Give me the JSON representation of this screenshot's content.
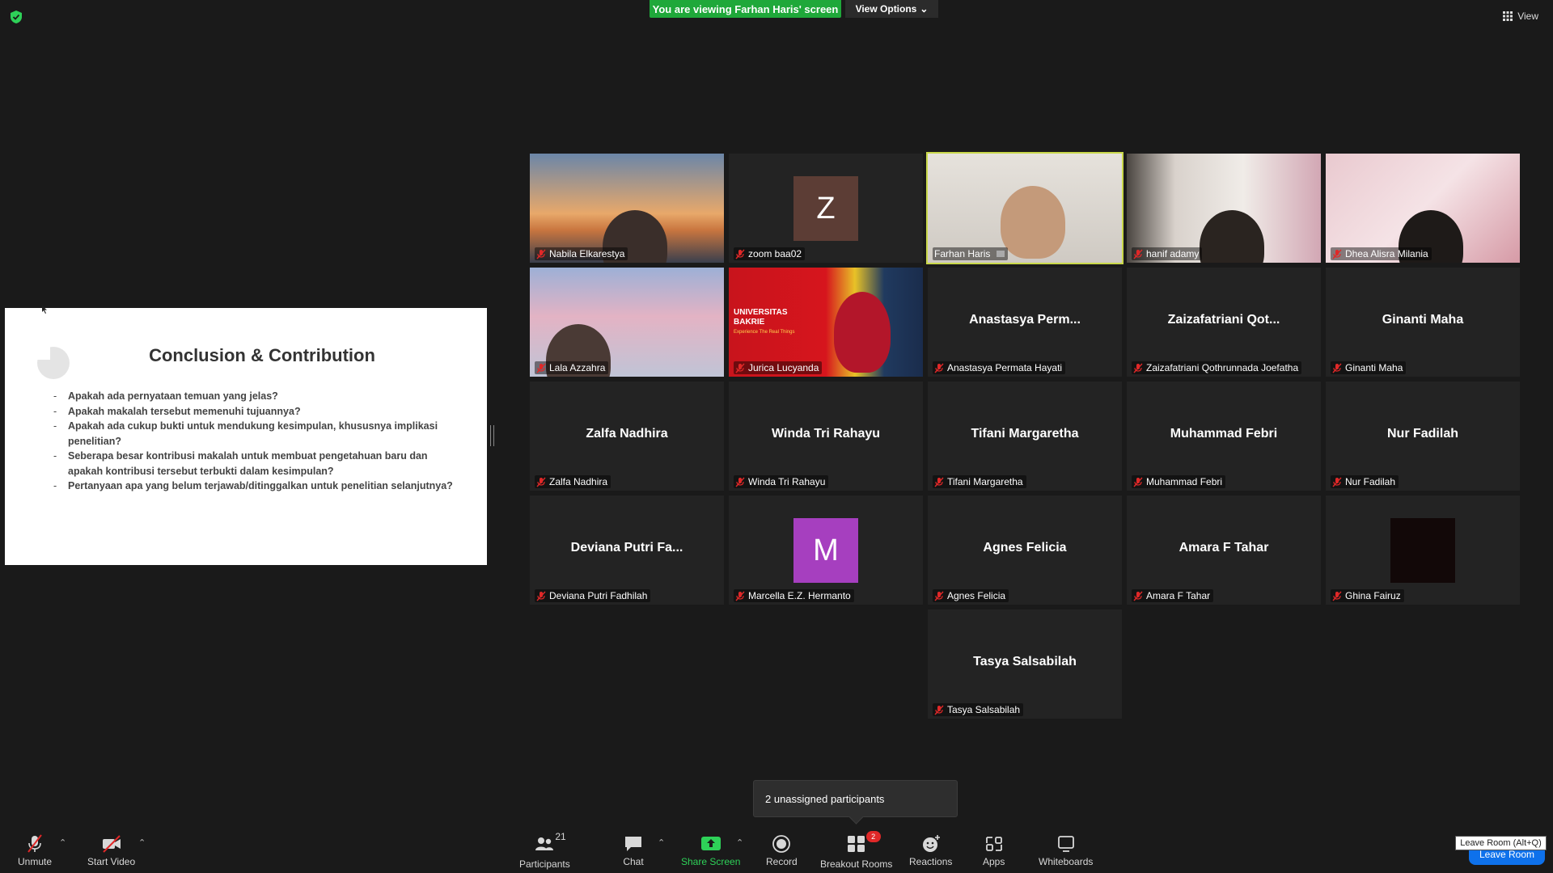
{
  "top": {
    "viewing_banner": "You are viewing Farhan Haris' screen",
    "view_options": "View Options",
    "view_button": "View"
  },
  "slide": {
    "title": "Conclusion & Contribution",
    "bullets": [
      "Apakah ada pernyataan temuan yang jelas?",
      "Apakah makalah tersebut memenuhi tujuannya?",
      "Apakah ada cukup bukti untuk mendukung kesimpulan, khususnya implikasi penelitian?",
      "Seberapa besar kontribusi makalah untuk membuat pengetahuan baru dan apakah kontribusi tersebut terbukti dalam kesimpulan?",
      "Pertanyaan apa yang belum terjawab/ditinggalkan untuk penelitian selanjutnya?"
    ]
  },
  "participants": [
    {
      "name": "Nabila Elkarestya",
      "kind": "video",
      "scene": "bridge"
    },
    {
      "name": "zoom baa02",
      "kind": "avatar",
      "avatar_letter": "Z",
      "avatar_color": "#5c3d35"
    },
    {
      "name": "Farhan Haris",
      "kind": "video",
      "scene": "room",
      "active": true
    },
    {
      "name": "hanif adamy",
      "kind": "video",
      "scene": "curtain"
    },
    {
      "name": "Dhea Alisra Milania",
      "kind": "video",
      "scene": "flower"
    },
    {
      "name": "Lala Azzahra",
      "kind": "video",
      "scene": "pink"
    },
    {
      "name": "Jurica Lucyanda",
      "kind": "video",
      "scene": "bakrie"
    },
    {
      "name": "Anastasya Permata Hayati",
      "kind": "name",
      "display": "Anastasya  Perm..."
    },
    {
      "name": "Zaizafatriani Qothrunnada Joefatha",
      "kind": "name",
      "display": "Zaizafatriani  Qot..."
    },
    {
      "name": "Ginanti Maha",
      "kind": "name",
      "display": "Ginanti Maha"
    },
    {
      "name": "Zalfa Nadhira",
      "kind": "name",
      "display": "Zalfa Nadhira"
    },
    {
      "name": "Winda Tri Rahayu",
      "kind": "name",
      "display": "Winda Tri Rahayu"
    },
    {
      "name": "Tifani Margaretha",
      "kind": "name",
      "display": "Tifani Margaretha"
    },
    {
      "name": "Muhammad Febri",
      "kind": "name",
      "display": "Muhammad Febri"
    },
    {
      "name": "Nur Fadilah",
      "kind": "name",
      "display": "Nur Fadilah"
    },
    {
      "name": "Deviana Putri Fadhilah",
      "kind": "name",
      "display": "Deviana  Putri  Fa..."
    },
    {
      "name": "Marcella E.Z. Hermanto",
      "kind": "avatar",
      "avatar_letter": "M",
      "avatar_color": "#a63fbf"
    },
    {
      "name": "Agnes Felicia",
      "kind": "name",
      "display": "Agnes Felicia"
    },
    {
      "name": "Amara F Tahar",
      "kind": "name",
      "display": "Amara F Tahar"
    },
    {
      "name": "Ghina Fairuz",
      "kind": "avatar",
      "avatar_letter": "",
      "avatar_color": "#120808"
    },
    {
      "name": "Tasya Salsabilah",
      "kind": "name",
      "display": "Tasya Salsabilah"
    }
  ],
  "bakrie": {
    "line1": "UNIVERSITAS",
    "line2": "BAKRIE",
    "line3": "Experience The Real Things"
  },
  "unassigned": "2 unassigned participants",
  "toolbar": {
    "unmute": "Unmute",
    "start_video": "Start Video",
    "participants": "Participants",
    "participants_count": "21",
    "chat": "Chat",
    "share_screen": "Share Screen",
    "record": "Record",
    "breakout_rooms": "Breakout Rooms",
    "breakout_badge": "2",
    "reactions": "Reactions",
    "apps": "Apps",
    "whiteboards": "Whiteboards",
    "leave_room": "Leave Room",
    "leave_tooltip": "Leave Room (Alt+Q)"
  },
  "colors": {
    "accent_green": "#1fa83a",
    "active_border": "#c9d84a",
    "leave_blue": "#0e71eb",
    "muted_red": "#e02828"
  }
}
